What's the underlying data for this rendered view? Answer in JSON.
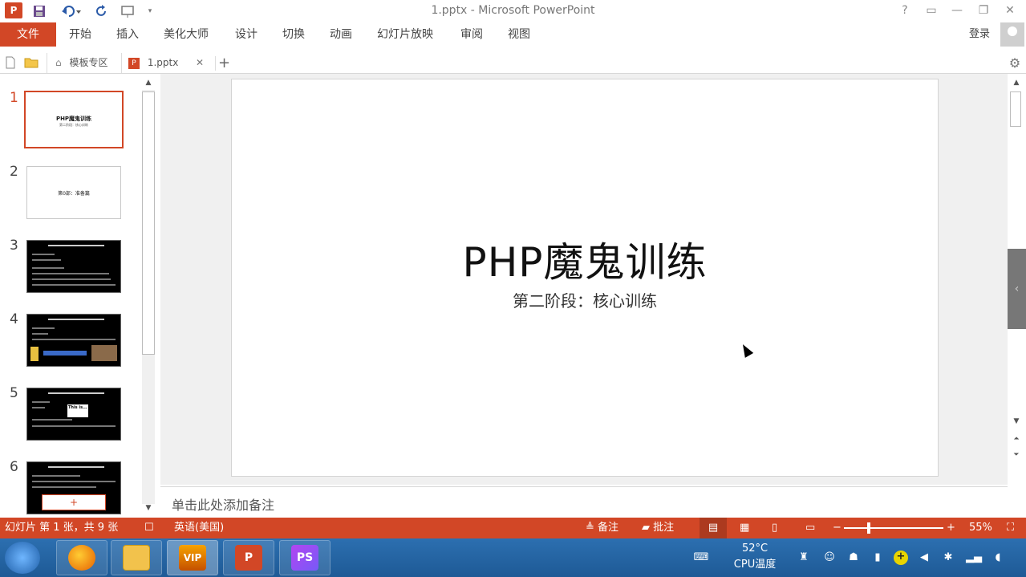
{
  "window": {
    "title": "1.pptx - Microsoft PowerPoint",
    "app_icon": "P",
    "controls": [
      "?",
      "▭",
      "—",
      "❐",
      "✕"
    ]
  },
  "ribbon": {
    "tabs": [
      "文件",
      "开始",
      "插入",
      "美化大师",
      "设计",
      "切换",
      "动画",
      "幻灯片放映",
      "审阅",
      "视图"
    ],
    "login": "登录"
  },
  "tabbar": {
    "template_tab": "模板专区",
    "doc_tab": "1.pptx",
    "add": "+"
  },
  "thumbnails": [
    {
      "number": "1",
      "title": "PHP魔鬼训练",
      "subtitle": "第二阶段：核心训练"
    },
    {
      "number": "2",
      "title": "第0部：准备篇",
      "subtitle": ""
    },
    {
      "number": "3",
      "title": "",
      "subtitle": ""
    },
    {
      "number": "4",
      "title": "",
      "subtitle": ""
    },
    {
      "number": "5",
      "title": "",
      "subtitle": "This is..."
    },
    {
      "number": "6",
      "title": "",
      "subtitle": "+"
    }
  ],
  "slide": {
    "title": "PHP魔鬼训练",
    "subtitle": "第二阶段：核心训练"
  },
  "notes": {
    "placeholder": "单击此处添加备注"
  },
  "statusbar": {
    "slide_info": "幻灯片 第 1 张，共 9 张",
    "language": "英语(美国)",
    "notes_label": "备注",
    "comments_label": "批注",
    "zoom": "55%",
    "zoom_level_percent": 55
  },
  "taskbar": {
    "ps_label": "PS",
    "ppt_label": "P",
    "vip_label": "VIP",
    "temperature": "52°C",
    "temp_label": "CPU温度"
  },
  "colors": {
    "accent": "#d24726"
  }
}
